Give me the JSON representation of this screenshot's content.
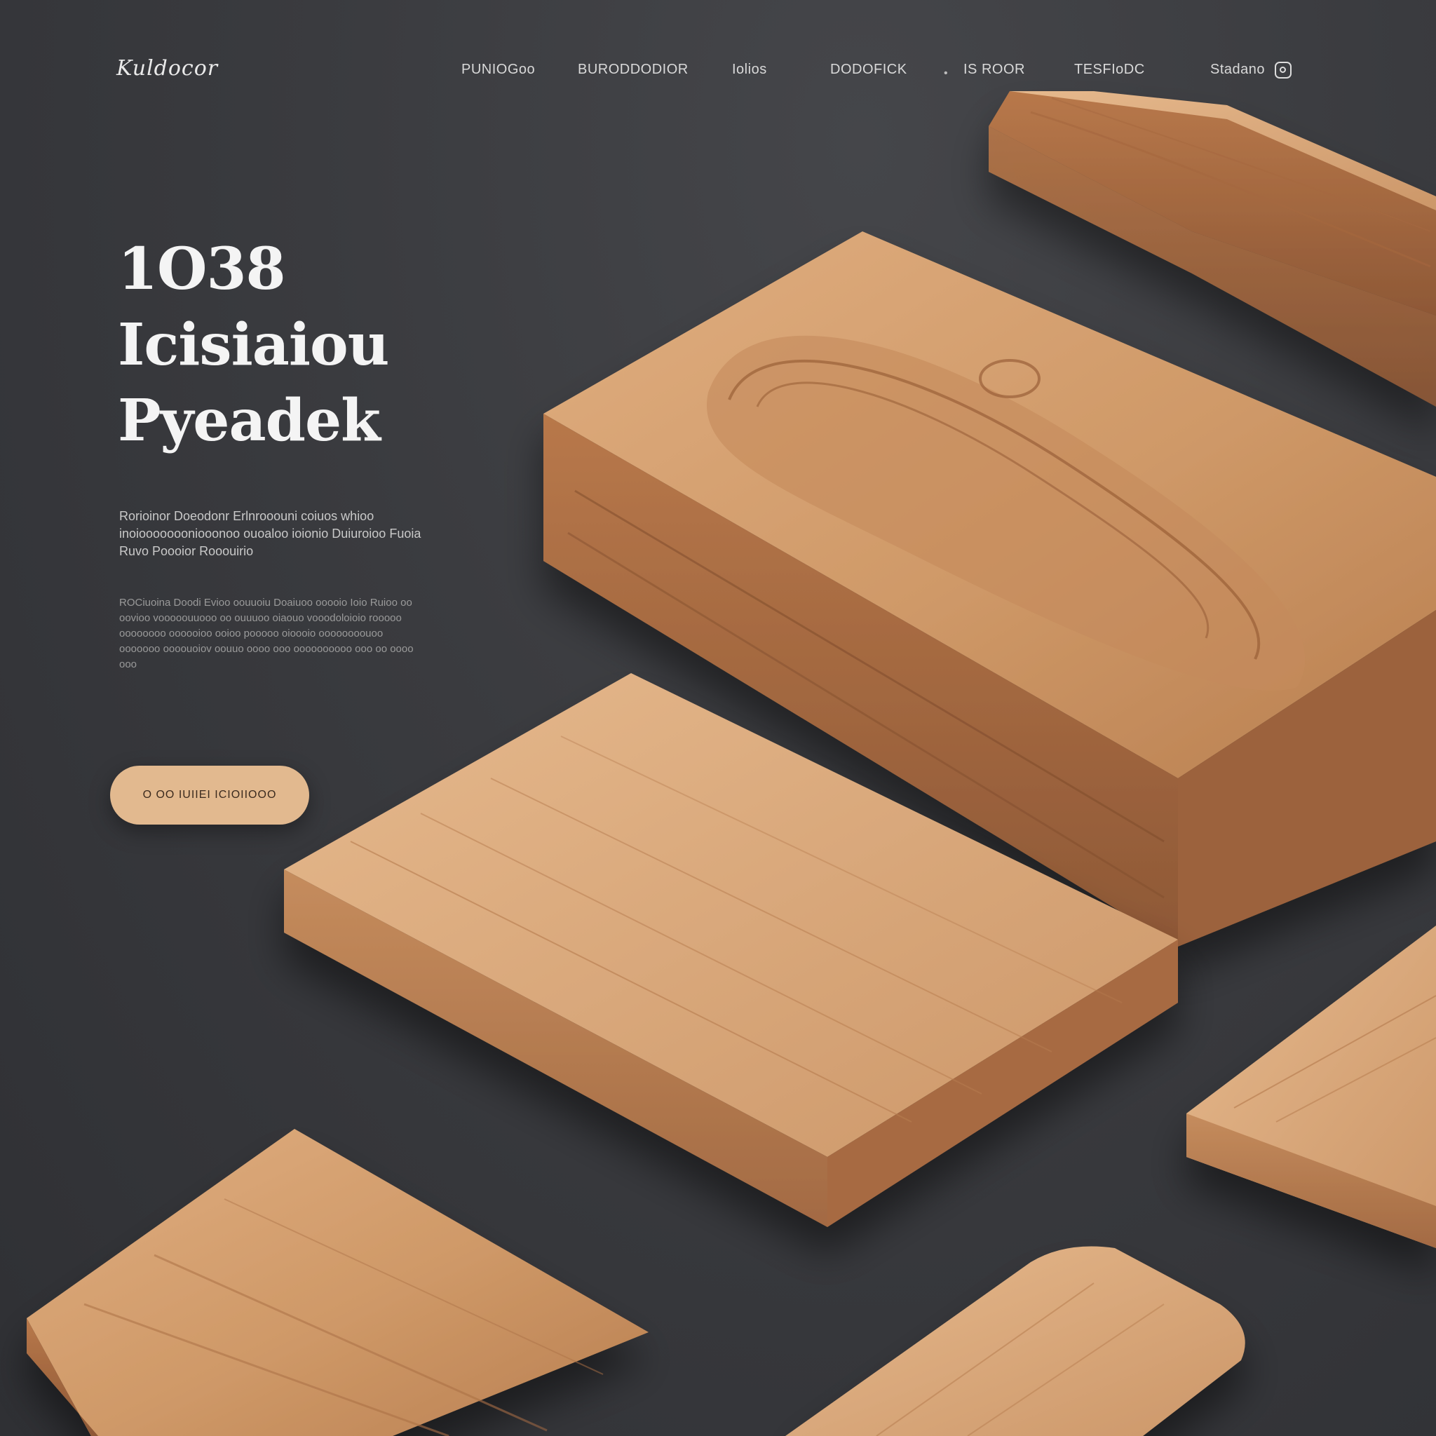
{
  "header": {
    "logo": "Kuldocor",
    "nav": [
      {
        "label": "PUNIOGoo"
      },
      {
        "label": "BURODDODIOR"
      },
      {
        "label": "Iolios"
      },
      {
        "label": "DODOFICK"
      },
      {
        "label": "IS ROOR"
      },
      {
        "label": "TESFIoDC"
      },
      {
        "label": "Stadano"
      }
    ],
    "instagram_icon": "instagram-icon"
  },
  "hero": {
    "title_lines": [
      "1O38",
      "Icisiaiou",
      "Pyeadek"
    ],
    "intro": "Rorioinor Doeodonr Erlnrooouni coiuos whioo inoioooooooniooonoo ouoaloo ioionio Duiuroioo Fuoia Ruvo Poooior Rooouirio",
    "body": "ROCiuoina Doodi Evioo oouuoiu Doaiuoo ooooio Ioio Ruioo oo oovioo vooooouuooo oo ouuuoo oiaouo vooodoloioio rooooo oooooooo oooooioo ooioo pooooo oioooio oooooooouoo ooooooo oooouoiov oouuo oooo ooo oooooooooo ooo oo oooo ooo",
    "cta_label": "O OO IUIIEI ICIOIIOOO"
  },
  "colors": {
    "background": "#3a3b3f",
    "accent": "#e2b98f",
    "wood_light": "#d9a679",
    "wood_dark": "#8e5836"
  }
}
